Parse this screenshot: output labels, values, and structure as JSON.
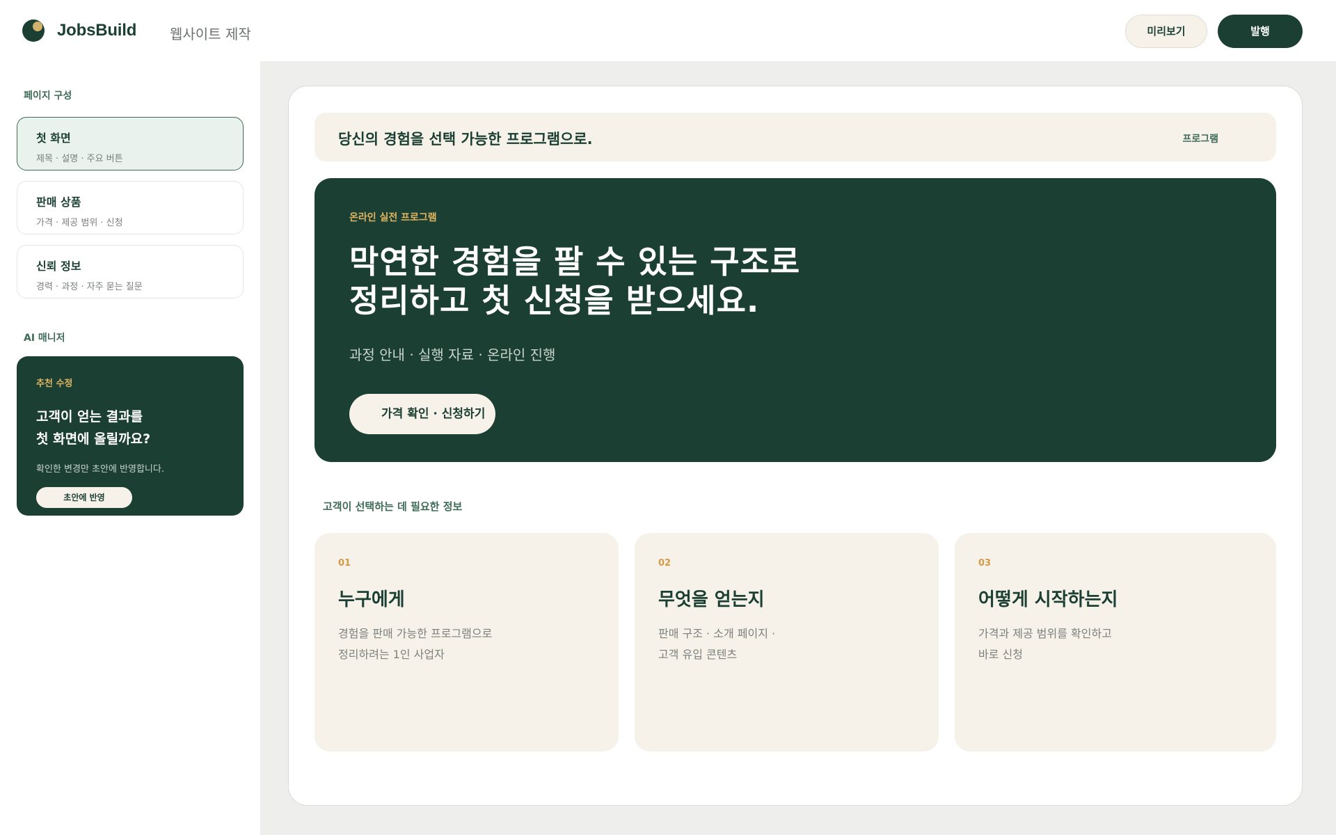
{
  "header": {
    "brand": "JobsBuild",
    "section": "웹사이트 제작",
    "preview_label": "미리보기",
    "publish_label": "발행"
  },
  "sidebar": {
    "pages_label": "페이지 구성",
    "items": [
      {
        "title": "첫 화면",
        "subtitle": "제목 · 설명 · 주요 버튼"
      },
      {
        "title": "판매 상품",
        "subtitle": "가격 · 제공 범위 · 신청"
      },
      {
        "title": "신뢰 정보",
        "subtitle": "경력 · 과정 · 자주 묻는 질문"
      }
    ],
    "ai_label": "AI 매니저",
    "ai_card": {
      "tag": "추천 수정",
      "title_line1": "고객이 얻는 결과를",
      "title_line2": "첫 화면에 올릴까요?",
      "desc": "확인한 변경만 초안에 반영합니다.",
      "button": "초안에 반영"
    }
  },
  "main": {
    "announce": {
      "text": "당신의 경험을 선택 가능한 프로그램으로.",
      "link": "프로그램"
    },
    "hero": {
      "tag": "온라인 실전 프로그램",
      "headline_line1": "막연한 경험을 팔 수 있는 구조로",
      "headline_line2": "정리하고 첫 신청을 받으세요.",
      "sub": "과정 안내 · 실행 자료 · 온라인 진행",
      "cta": "가격 확인 · 신청하기"
    },
    "info_label": "고객이 선택하는 데 필요한 정보",
    "cards": [
      {
        "num": "01",
        "title": "누구에게",
        "line1": "경험을 판매 가능한 프로그램으로",
        "line2": "정리하려는 1인 사업자"
      },
      {
        "num": "02",
        "title": "무엇을 얻는지",
        "line1": "판매 구조 · 소개 페이지 ·",
        "line2": "고객 유입 콘텐츠"
      },
      {
        "num": "03",
        "title": "어떻게 시작하는지",
        "line1": "가격과 제공 범위를 확인하고",
        "line2": "바로 신청"
      }
    ]
  },
  "colors": {
    "brand_green": "#1b3f33",
    "accent_gold": "#e0b560",
    "cream": "#f6f2ea"
  }
}
